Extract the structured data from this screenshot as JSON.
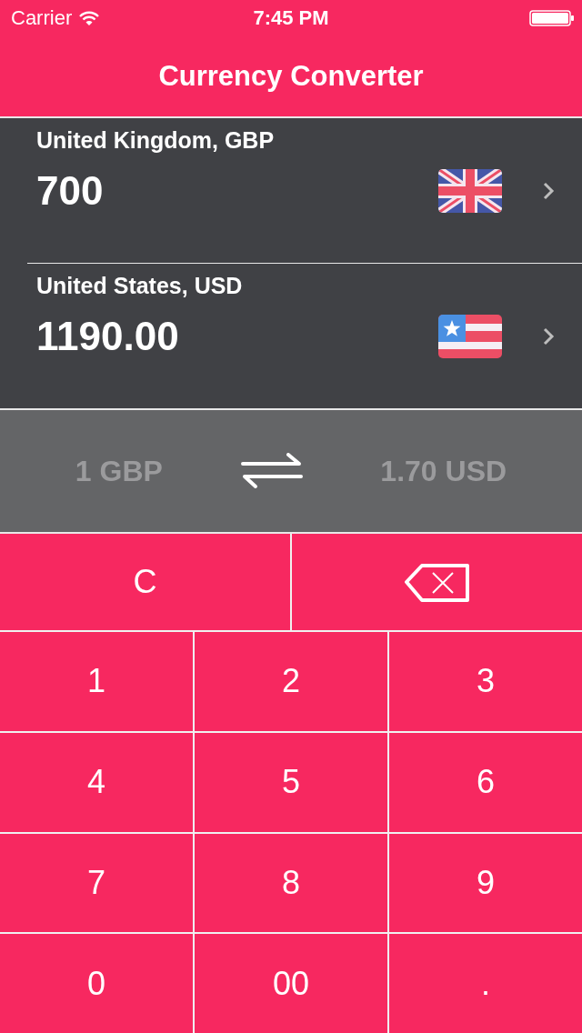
{
  "status_bar": {
    "carrier": "Carrier",
    "time": "7:45 PM"
  },
  "nav": {
    "title": "Currency Converter"
  },
  "currencies": [
    {
      "label": "United Kingdom, GBP",
      "amount": "700"
    },
    {
      "label": "United States, USD",
      "amount": "1190.00"
    }
  ],
  "rate": {
    "from": "1 GBP",
    "to": "1.70 USD"
  },
  "keys": [
    [
      {
        "kind": "text",
        "label": "C"
      },
      {
        "kind": "backspace"
      }
    ],
    [
      {
        "kind": "text",
        "label": "1"
      },
      {
        "kind": "text",
        "label": "2"
      },
      {
        "kind": "text",
        "label": "3"
      }
    ],
    [
      {
        "kind": "text",
        "label": "4"
      },
      {
        "kind": "text",
        "label": "5"
      },
      {
        "kind": "text",
        "label": "6"
      }
    ],
    [
      {
        "kind": "text",
        "label": "7"
      },
      {
        "kind": "text",
        "label": "8"
      },
      {
        "kind": "text",
        "label": "9"
      }
    ],
    [
      {
        "kind": "text",
        "label": "0"
      },
      {
        "kind": "text",
        "label": "00"
      },
      {
        "kind": "text",
        "label": "."
      }
    ]
  ]
}
